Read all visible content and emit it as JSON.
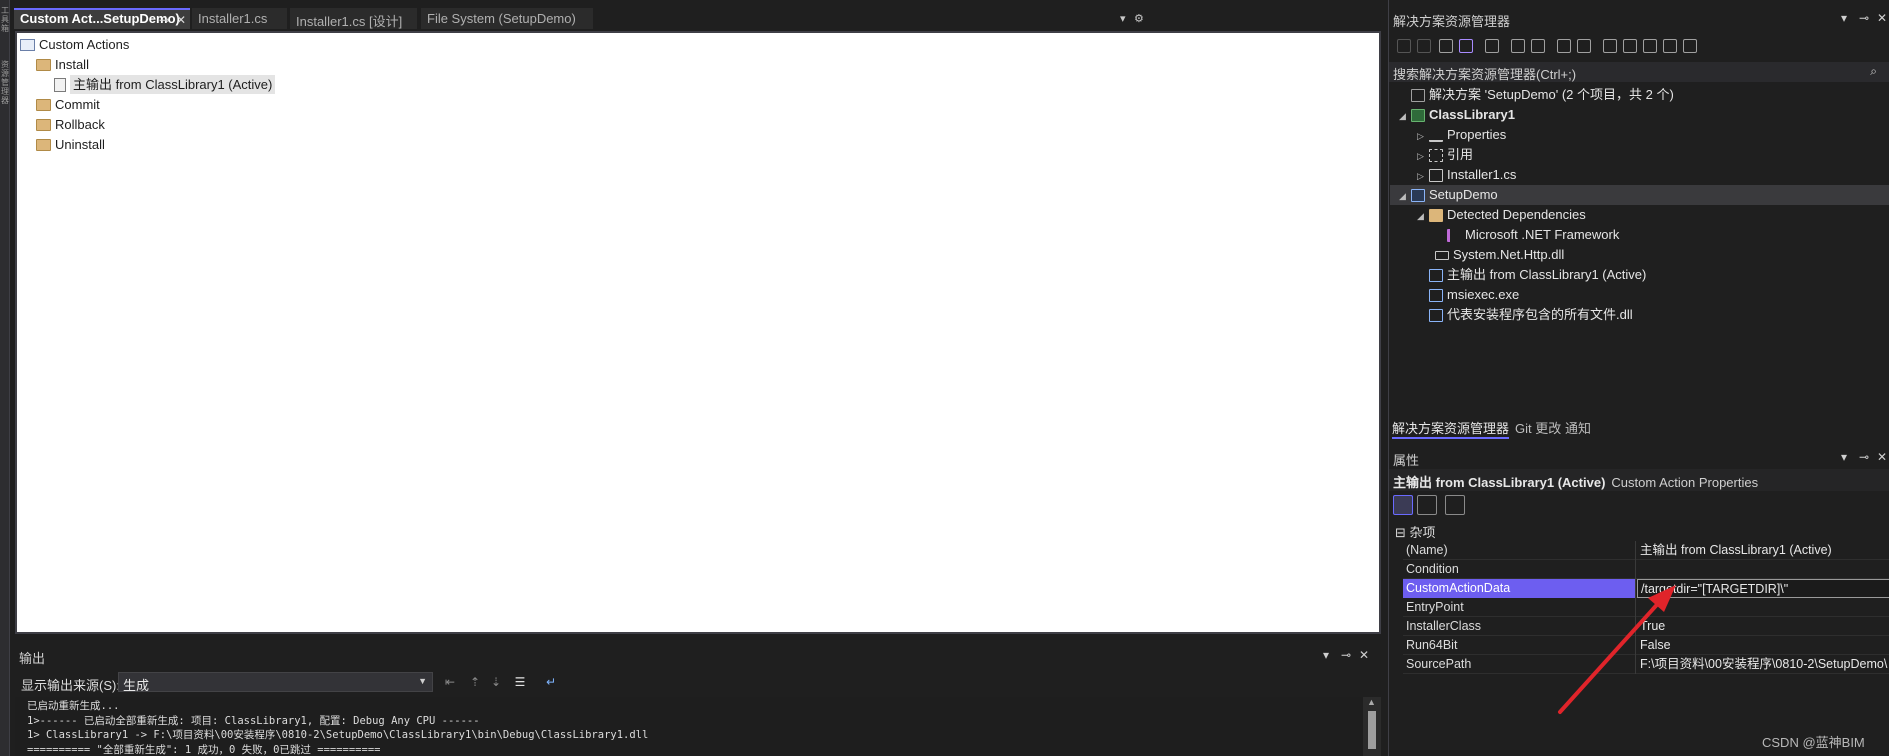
{
  "left_strip": {
    "top_label": "工具箱",
    "bottom_label": "资源管理器"
  },
  "doc_tabs": [
    {
      "label": "Custom Act...SetupDemo)",
      "active": true
    },
    {
      "label": "Installer1.cs",
      "active": false
    },
    {
      "label": "Installer1.cs [设计]",
      "active": false
    },
    {
      "label": "File System (SetupDemo)",
      "active": false
    }
  ],
  "doc_tab_icons": {
    "pin": "⊸",
    "close": "✕",
    "dropdown": "▾",
    "settings": "⚙"
  },
  "custom_actions": {
    "root": "Custom Actions",
    "install": "Install",
    "install_child": "主输出 from ClassLibrary1 (Active)",
    "commit": "Commit",
    "rollback": "Rollback",
    "uninstall": "Uninstall"
  },
  "output": {
    "title": "输出",
    "source_label": "显示输出来源(S):",
    "source_value": "生成",
    "lines": [
      "已启动重新生成...",
      "1>------ 已启动全部重新生成: 项目: ClassLibrary1, 配置: Debug Any CPU ------",
      "1>  ClassLibrary1 -> F:\\项目资料\\00安装程序\\0810-2\\SetupDemo\\ClassLibrary1\\bin\\Debug\\ClassLibrary1.dll",
      "========== \"全部重新生成\": 1 成功，0 失败，0已跳过 =========="
    ]
  },
  "solution_explorer": {
    "title": "解决方案资源管理器",
    "search_placeholder": "搜索解决方案资源管理器(Ctrl+;)",
    "solution": "解决方案 'SetupDemo' (2 个项目，共 2 个)",
    "project1": "ClassLibrary1",
    "properties": "Properties",
    "references": "引用",
    "installer": "Installer1.cs",
    "project2": "SetupDemo",
    "detected": "Detected Dependencies",
    "netfw": "Microsoft .NET Framework",
    "httpdll": "System.Net.Http.dll",
    "primary_output": "主输出 from ClassLibrary1 (Active)",
    "msiexec": "msiexec.exe",
    "all_files": "代表安装程序包含的所有文件.dll",
    "tabs": [
      "解决方案资源管理器",
      "Git 更改",
      "通知"
    ]
  },
  "properties": {
    "title": "属性",
    "object_name": "主输出 from ClassLibrary1 (Active)",
    "object_type": "Custom Action Properties",
    "category": "杂项",
    "rows": [
      {
        "key": "(Name)",
        "value": "主输出 from ClassLibrary1 (Active)"
      },
      {
        "key": "Condition",
        "value": ""
      },
      {
        "key": "CustomActionData",
        "value": "/targetdir=\"[TARGETDIR]\\\""
      },
      {
        "key": "EntryPoint",
        "value": ""
      },
      {
        "key": "InstallerClass",
        "value": "True"
      },
      {
        "key": "Run64Bit",
        "value": "False"
      },
      {
        "key": "SourcePath",
        "value": "F:\\项目资料\\00安装程序\\0810-2\\SetupDemo\\"
      }
    ]
  },
  "watermark": "CSDN @蓝神BIM",
  "colors": {
    "accent": "#6d5ef0",
    "folder": "#dcb67a",
    "arrow": "#e0242a"
  }
}
